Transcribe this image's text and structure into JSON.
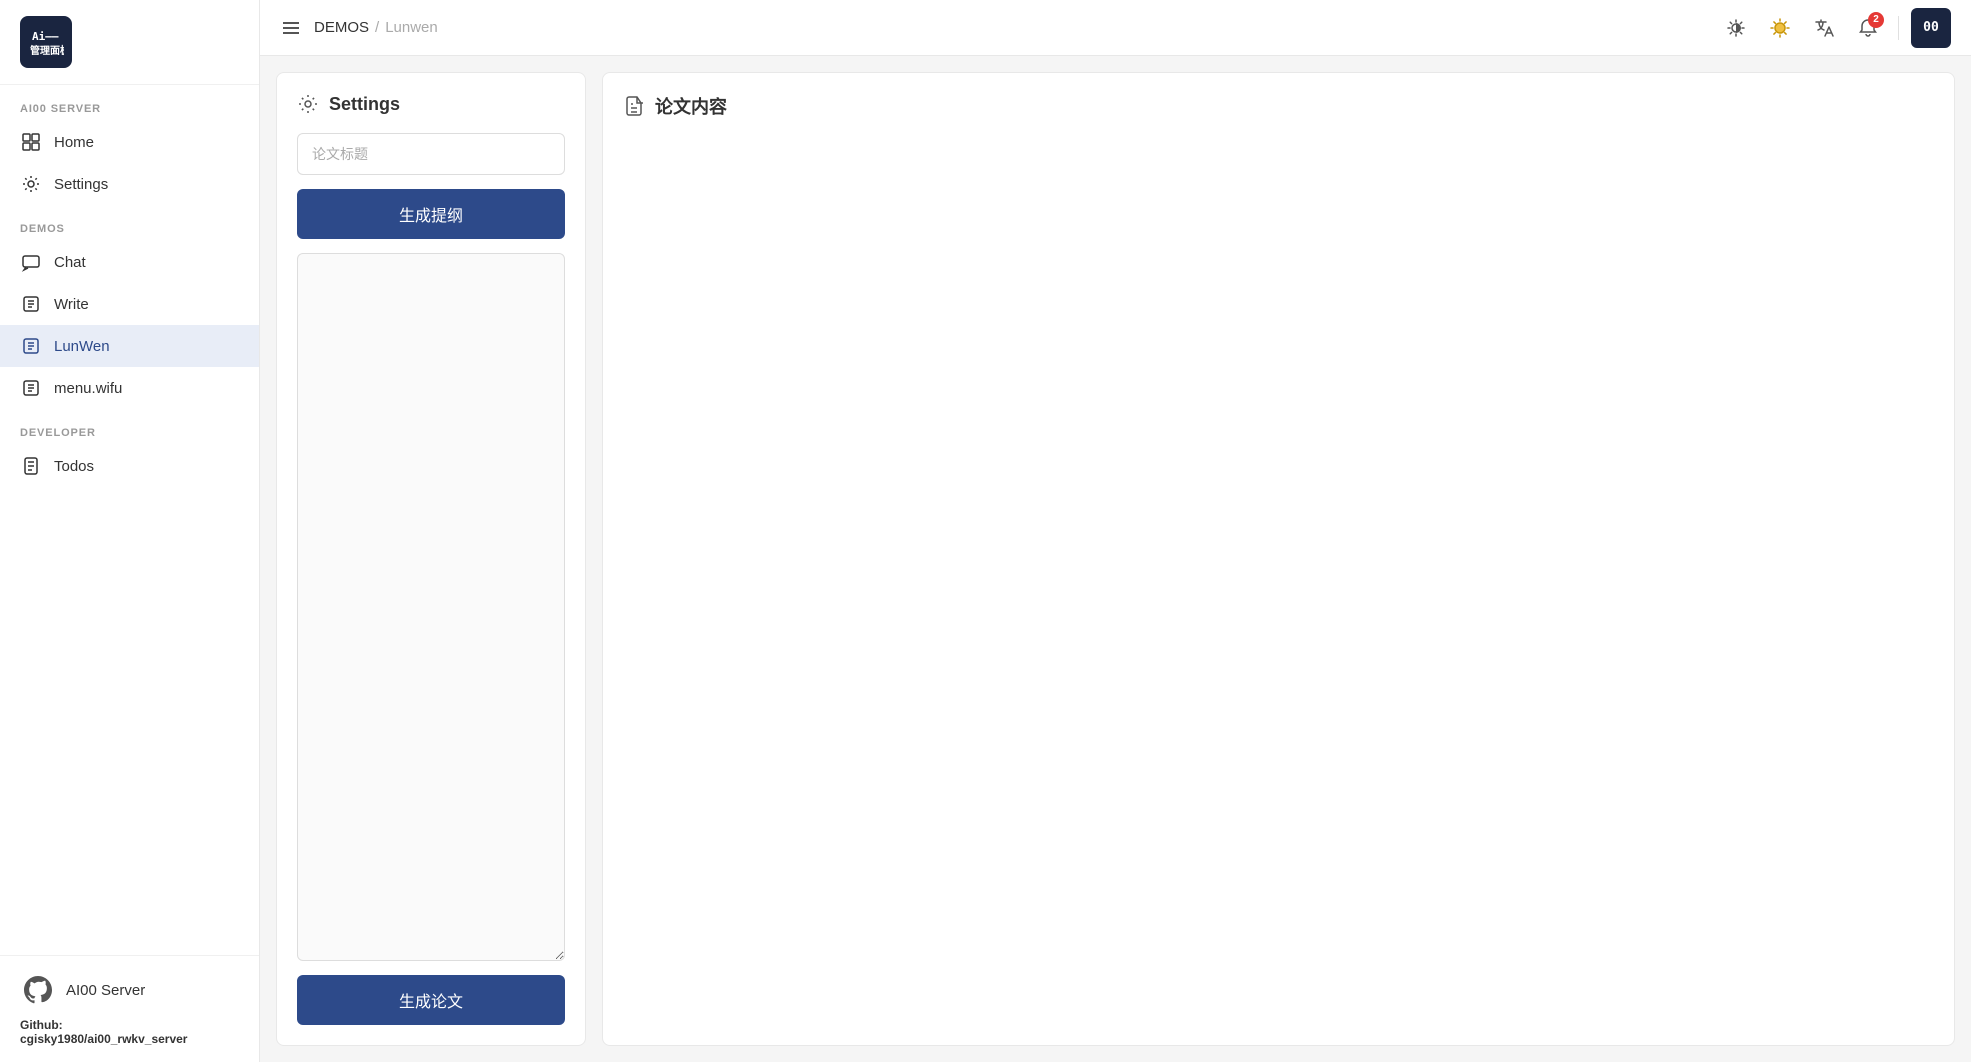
{
  "sidebar": {
    "logo_line1": "Ai——",
    "logo_line2": "管理面板",
    "sections": [
      {
        "label": "AI00 SERVER",
        "items": [
          {
            "id": "home",
            "text": "Home",
            "active": false
          },
          {
            "id": "settings",
            "text": "Settings",
            "active": false
          }
        ]
      },
      {
        "label": "DEMOS",
        "items": [
          {
            "id": "chat",
            "text": "Chat",
            "active": false
          },
          {
            "id": "write",
            "text": "Write",
            "active": false
          },
          {
            "id": "lunwen",
            "text": "LunWen",
            "active": true
          },
          {
            "id": "menu-wifu",
            "text": "menu.wifu",
            "active": false
          }
        ]
      },
      {
        "label": "DEVELOPER",
        "items": [
          {
            "id": "todos",
            "text": "Todos",
            "active": false
          }
        ]
      }
    ],
    "footer": {
      "server_name": "AI00 Server",
      "github_label": "Github:",
      "github_url": "cgisky1980/ai00_rwkv_server"
    }
  },
  "header": {
    "breadcrumb_root": "DEMOS",
    "breadcrumb_sep": "/",
    "breadcrumb_current": "Lunwen"
  },
  "notifications": {
    "count": "2"
  },
  "terminal": {
    "label": "00"
  },
  "left_panel": {
    "title": "Settings",
    "title_input_placeholder": "论文标题",
    "generate_outline_btn": "生成提纲",
    "outline_textarea_placeholder": "",
    "generate_paper_btn": "生成论文"
  },
  "right_panel": {
    "title": "论文内容"
  }
}
